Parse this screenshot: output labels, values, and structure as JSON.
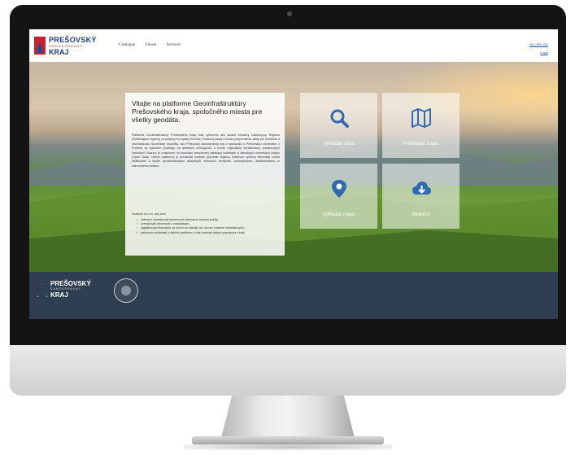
{
  "site": {
    "logo": {
      "line1": "PREŠOVSKÝ",
      "line2": "SAMOSPRÁVNY",
      "line3": "KRAJ"
    },
    "nav": [
      "Catalogue",
      "Viewer",
      "Services"
    ],
    "lang": {
      "primary": "SK | EN | DE",
      "secondary": "Login"
    }
  },
  "intro": {
    "title": "Vitajte na platforme Geoinfraštruktúry Prešovského kraja, spoločného miesta pre všetky geodáta.",
    "body": "Platforma Geoinfraštruktúry Prešovského kraja bola vytvorená ako súčasť iniciatívy Catching-up Regions (Dobiehajúce regióny) za podpory Európskej Komisie, Svetovej banky a Úradu podpredsedu vlády pre investície a informatizáciu Slovenskej republiky. Ako Prešovský samosprávny kraj v spolupráci s Prešovskou univerzitou v Prešove sa spoločne podieľajú na aktivitách smerujúcich k tvorbe regionálnej infraštruktúry priestorových informácií. Nosnou je postavené na budovaní komplexnej databázy kvalitných a aktuálnych otvorených údajov (Open Data). Cieľom platformy je prevádzať kvalitné poznanie regiónu, efektívne výmeny informácií medzi inštitúciami a lepšie sprostredkovanie aktuálnych informácií verejnosti, samosprávam, akademickému či súkromnému sektoru.",
    "list_title": "Snažíme sa o to, aby sme:",
    "bullets": [
      "zbierali a zverejňovali priestorové informácie vysokej kvality,",
      "zverejňovali informácie o metadátach,",
      "digitalizovali informácie na úrovni sú zdieľajú inú úrovne (vrátane metadátových),",
      "platformu rozširovali o ďalších partnerov, a tak budovali základ prepojenia s kraji."
    ]
  },
  "tiles": [
    {
      "label": "Vyhľadať dáta",
      "icon": "search-icon"
    },
    {
      "label": "Prehliadať mapu",
      "icon": "map-icon"
    },
    {
      "label": "Vyhľadať mapu",
      "icon": "map-pin-icon"
    },
    {
      "label": "Stiahnuť",
      "icon": "cloud-download-icon"
    }
  ],
  "footer": {
    "logo": {
      "line1": "PREŠOVSKÝ",
      "line2": "SAMOSPRÁVNY",
      "line3": "KRAJ"
    }
  },
  "colors": {
    "accent": "#2f6bb0",
    "footer": "#2f3e50",
    "brand_red": "#c8232c",
    "brand_blue": "#1a3e8a"
  }
}
